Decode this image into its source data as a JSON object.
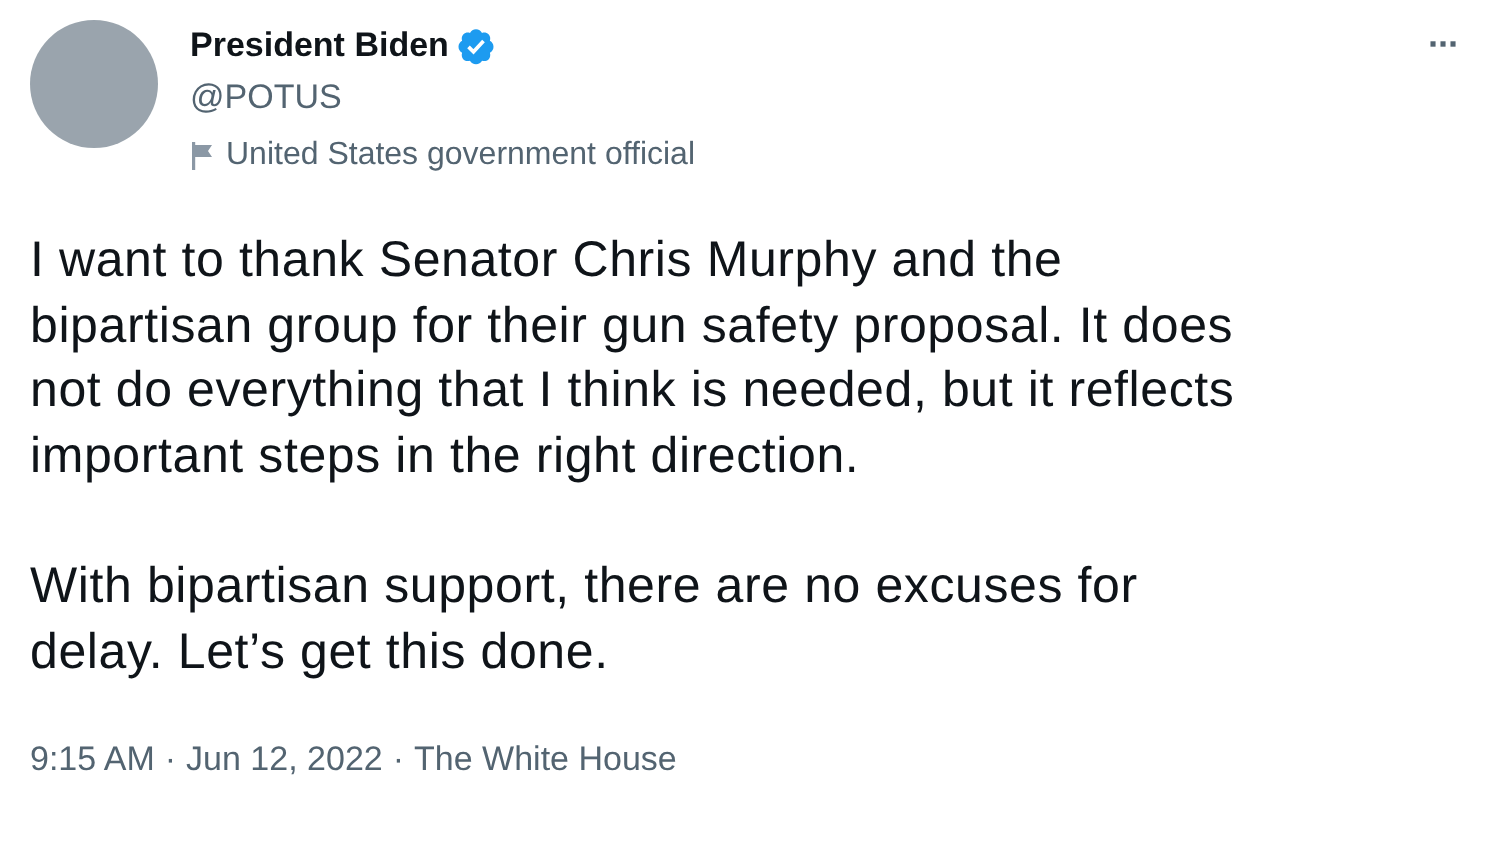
{
  "author": {
    "name": "President Biden",
    "handle": "@POTUS",
    "label": "United States government official"
  },
  "more_button": "···",
  "paragraphs": [
    "I want to thank Senator Chris Murphy and the\nbipartisan group for their gun safety proposal. It does\nnot do everything that I think is needed, but it reflects\nimportant steps in the right direction.",
    "With bipartisan support, there are no excuses for\ndelay. Let’s get this done."
  ],
  "meta": {
    "time": "9:15 AM",
    "separators": [
      "·",
      "·"
    ],
    "date": "Jun 12, 2022",
    "source": "The White House"
  }
}
